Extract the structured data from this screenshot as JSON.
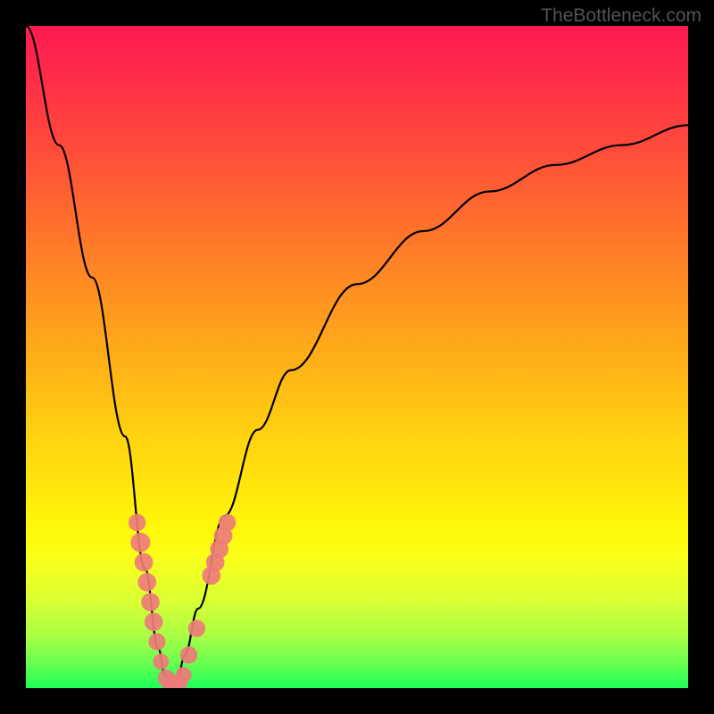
{
  "watermark": "TheBottleneck.com",
  "chart_data": {
    "type": "line",
    "title": "",
    "xlabel": "",
    "ylabel": "",
    "xlim": [
      0,
      100
    ],
    "ylim": [
      0,
      100
    ],
    "grid": false,
    "legend": false,
    "background": "rainbow-gradient",
    "series": [
      {
        "name": "bottleneck-curve",
        "shape": "v",
        "minimum_x": 22,
        "x": [
          0,
          5,
          10,
          15,
          18,
          20,
          21,
          22,
          23,
          24,
          26,
          30,
          35,
          40,
          50,
          60,
          70,
          80,
          90,
          100
        ],
        "y": [
          100,
          82,
          62,
          38,
          18,
          6,
          2,
          0,
          2,
          5,
          12,
          26,
          39,
          48,
          61,
          69,
          75,
          79,
          82,
          85
        ]
      }
    ],
    "markers": [
      {
        "name": "marker",
        "x": 16.8,
        "y": 25,
        "r": 1.0
      },
      {
        "name": "marker",
        "x": 17.3,
        "y": 22,
        "r": 1.2
      },
      {
        "name": "marker",
        "x": 17.8,
        "y": 19,
        "r": 1.1
      },
      {
        "name": "marker",
        "x": 18.3,
        "y": 16,
        "r": 1.1
      },
      {
        "name": "marker",
        "x": 18.8,
        "y": 13,
        "r": 1.1
      },
      {
        "name": "marker",
        "x": 19.3,
        "y": 10,
        "r": 1.1
      },
      {
        "name": "marker",
        "x": 19.8,
        "y": 7,
        "r": 1.0
      },
      {
        "name": "marker",
        "x": 20.4,
        "y": 4,
        "r": 0.9
      },
      {
        "name": "marker",
        "x": 21.2,
        "y": 1.5,
        "r": 1.0
      },
      {
        "name": "marker",
        "x": 22.0,
        "y": 0.5,
        "r": 1.1
      },
      {
        "name": "marker",
        "x": 23.0,
        "y": 0.7,
        "r": 1.1
      },
      {
        "name": "marker",
        "x": 23.8,
        "y": 2,
        "r": 0.9
      },
      {
        "name": "marker",
        "x": 24.6,
        "y": 5,
        "r": 1.0
      },
      {
        "name": "marker",
        "x": 25.8,
        "y": 9,
        "r": 1.0
      },
      {
        "name": "marker",
        "x": 28.0,
        "y": 17,
        "r": 1.1
      },
      {
        "name": "marker",
        "x": 28.6,
        "y": 19,
        "r": 1.1
      },
      {
        "name": "marker",
        "x": 29.2,
        "y": 21,
        "r": 1.1
      },
      {
        "name": "marker",
        "x": 29.8,
        "y": 23,
        "r": 1.1
      },
      {
        "name": "marker",
        "x": 30.4,
        "y": 25,
        "r": 1.0
      }
    ],
    "marker_color": "#ed7c79"
  }
}
